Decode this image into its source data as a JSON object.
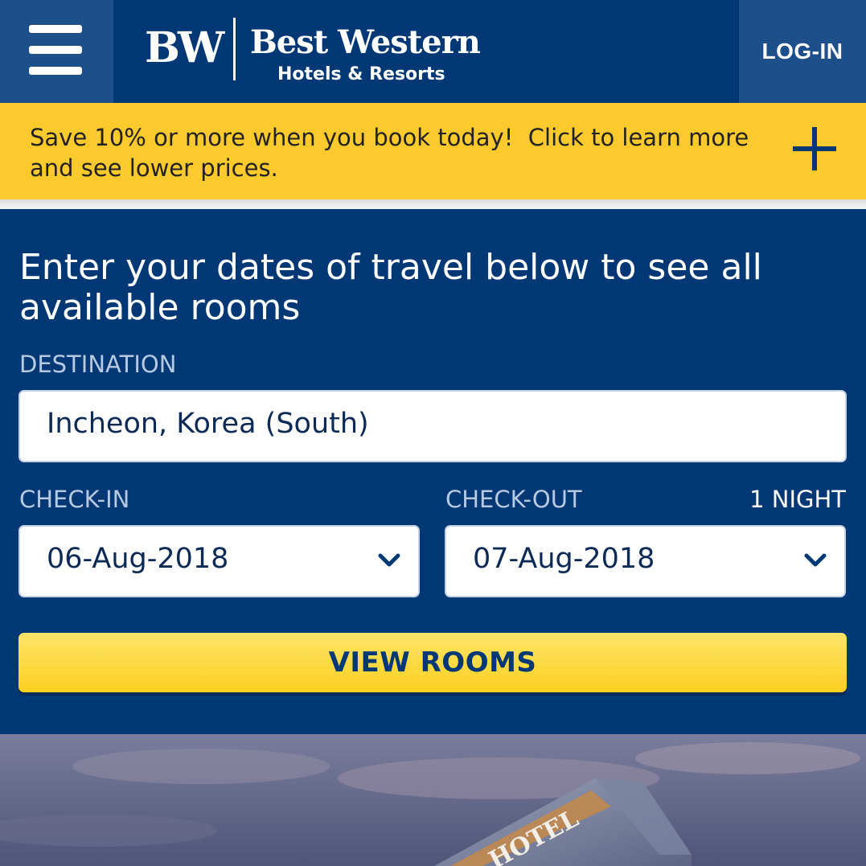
{
  "header": {
    "logo_mark": "BW",
    "logo_name": "Best Western",
    "logo_sub": "Hotels & Resorts",
    "login_label": "LOG-IN"
  },
  "promo": {
    "text": "Save 10% or more when you book today!  Click to learn more and see lower prices."
  },
  "booking": {
    "heading": "Enter your dates of travel below to see all available rooms",
    "destination_label": "DESTINATION",
    "destination_value": "Incheon, Korea (South)",
    "checkin_label": "CHECK-IN",
    "checkin_value": "06-Aug-2018",
    "checkout_label": "CHECK-OUT",
    "checkout_value": "07-Aug-2018",
    "nights_label": "1 NIGHT",
    "view_rooms_label": "VIEW ROOMS"
  },
  "hero": {
    "sign_text": "HOTEL"
  },
  "colors": {
    "brand_blue": "#003876",
    "header_button_blue": "#1d4f8a",
    "promo_yellow": "#fdca2e",
    "button_yellow": "#fcd020"
  },
  "icons": {
    "menu": "hamburger-icon",
    "promo": "plus-icon",
    "dropdown": "chevron-down-icon"
  }
}
